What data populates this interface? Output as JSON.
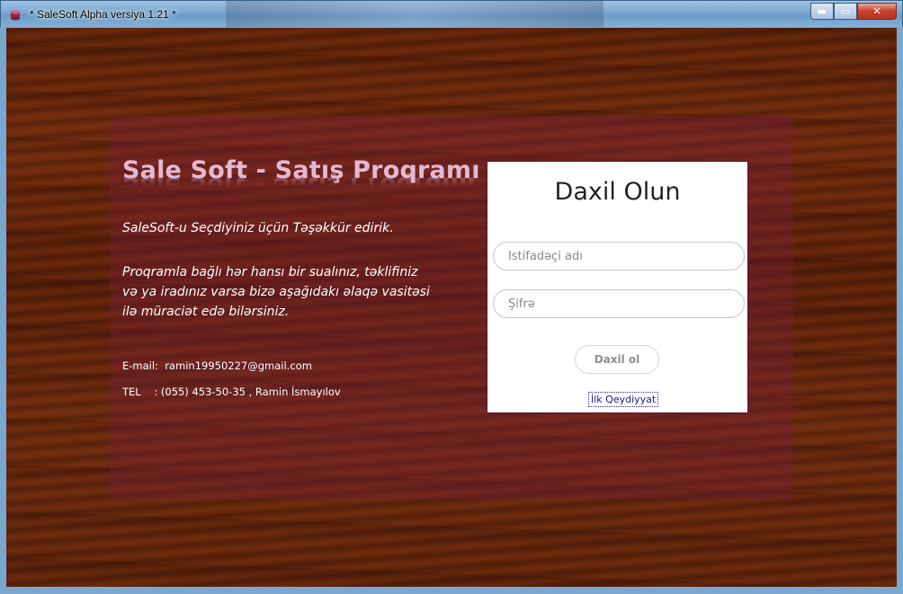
{
  "window": {
    "title": "* SaleSoft Alpha versiya 1.21 *",
    "minimize_glyph": "▬",
    "maximize_glyph": "▭",
    "close_glyph": "✕",
    "icons": [
      "app-icon",
      "minimize-icon",
      "maximize-icon",
      "close-icon"
    ]
  },
  "info": {
    "heading": "Sale Soft - Satış Proqramı",
    "thanks": "SaleSoft-u Seçdiyiniz üçün Təşəkkür edirik.",
    "description_lines": [
      "Proqramla bağlı hər hansı bir sualınız, təklifiniz",
      "və ya iradınız varsa bizə aşağıdakı əlaqə vasitəsi",
      "ilə  müraciət edə bilərsiniz."
    ],
    "email_label": "E-mail:",
    "email_value": "ramin19950227@gmail.com",
    "tel_label": "TEL    :",
    "tel_value": "(055) 453-50-35 , Ramin İsmayılov"
  },
  "login": {
    "title": "Daxil Olun",
    "username_placeholder": "İstifadəçi adı",
    "username_value": "",
    "password_placeholder": "Şifrə",
    "password_value": "",
    "submit_label": "Daxil ol",
    "register_label": "İlk Qeydiyyat"
  },
  "colors": {
    "heading": "#e5b8d2",
    "wood_base": "#5c2208",
    "overlay": "#78203c",
    "login_border": "#5a1030",
    "link": "#1a1a9a"
  }
}
